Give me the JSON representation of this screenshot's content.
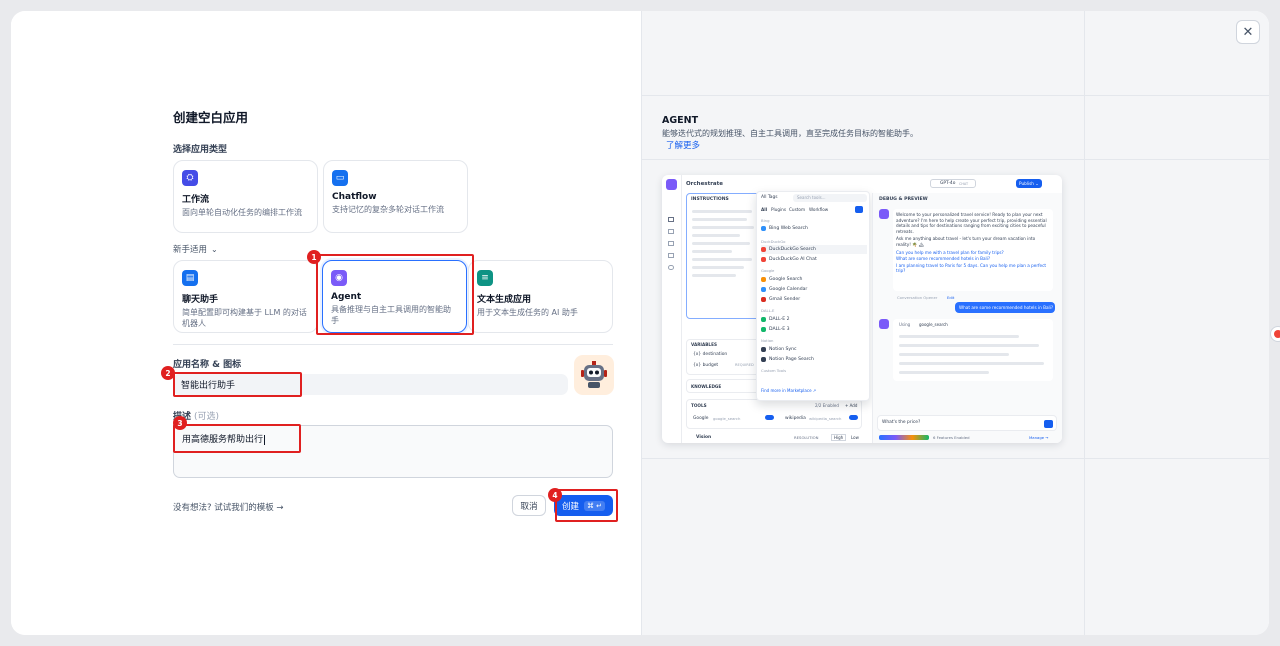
{
  "left": {
    "title": "创建空白应用",
    "type_label": "选择应用类型",
    "cards": [
      {
        "name": "工作流",
        "desc": "面向单轮自动化任务的编排工作流"
      },
      {
        "name": "Chatflow",
        "desc": "支持记忆的复杂多轮对话工作流"
      }
    ],
    "beginner_label": "新手适用",
    "beginner_cards": [
      {
        "name": "聊天助手",
        "desc": "简单配置即可构建基于 LLM 的对话机器人"
      },
      {
        "name": "Agent",
        "desc": "具备推理与自主工具调用的智能助手"
      },
      {
        "name": "文本生成应用",
        "desc": "用于文本生成任务的 AI 助手"
      }
    ],
    "name_label": "应用名称 & 图标",
    "name_value": "智能出行助手",
    "desc_label": "描述",
    "desc_optional": "(可选)",
    "desc_value": "用高德服务帮助出行",
    "template_link": "没有想法? 试试我们的模板 →",
    "cancel_label": "取消",
    "create_label": "创建",
    "create_shortcut": "⌘ ↵",
    "badges": [
      "1",
      "2",
      "3",
      "4"
    ]
  },
  "right": {
    "heading": "AGENT",
    "description": "能够迭代式的规划推理、自主工具调用，直至完成任务目标的智能助手。",
    "learn_more": "了解更多",
    "preview": {
      "orchestrate": "Orchestrate",
      "instructions": "INSTRUCTIONS",
      "all_tags": "All Tags",
      "search_tools": "Search tools...",
      "filter_tabs": [
        "All",
        "Plugins",
        "Custom",
        "Workflow"
      ],
      "sections": {
        "bing": "Bing",
        "duckduckgo": "DuckDuckGo",
        "google": "Google",
        "dalle": "DALL-E",
        "notion": "Notion",
        "custom_tools": "Custom Tools"
      },
      "tools": [
        "Bing Web Search",
        "DuckDuckGo Search",
        "DuckDuckGo AI Chat",
        "Google Search",
        "Google Calendar",
        "Gmail Sender",
        "DALL-E 2",
        "DALL-E 3",
        "Notion Sync",
        "Notion Page Search"
      ],
      "find_more": "Find more in Marketplace ↗",
      "variables": "VARIABLES",
      "var1": "{x} destination",
      "var2": "{x} budget",
      "required": "REQUIRED",
      "knowledge": "KNOWLEDGE",
      "tools_label": "TOOLS",
      "tools_enabled": "2/2 Enabled",
      "add": "+ Add",
      "tool1": "Google",
      "tool1_id": "google_search",
      "tool2": "wikipedia",
      "tool2_id": "wikipedia_search",
      "vision": "Vision",
      "resolution": "RESOLUTION",
      "high": "High",
      "low": "Low",
      "model": "GPT-4o",
      "chat_badge": "CHAT",
      "publish": "Publish ⌄",
      "debug": "DEBUG & PREVIEW",
      "welcome": "Welcome to your personalized travel service! Ready to plan your next adventure? I'm here to help create your perfect trip, providing essential details and tips for destinations ranging from exciting cities to peaceful retreats.",
      "ask": "Ask me anything about travel - let's turn your dream vacation into reality! 🌴 🏔",
      "q1": "Can you help me with a travel plan for family trips?",
      "q2": "What are some recommended hotels in Bali?",
      "q3": "I am planning travel to Paris for 5 days. Can you help me plan a perfect trip?",
      "opener": "Conversation Opener",
      "edit": "Edit",
      "user_msg": "What are some recommended hotels in Bali?",
      "using": "Using",
      "using_tool": "google_search",
      "input_text": "What's the price?",
      "features": "6 Features Enabled",
      "manage": "Manage →"
    }
  },
  "colors": {
    "primary": "#155eef",
    "annotation": "#e02020"
  }
}
